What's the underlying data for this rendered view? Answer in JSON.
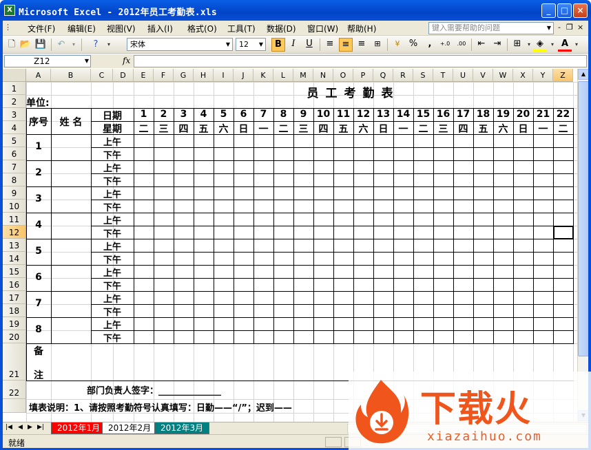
{
  "window": {
    "title": "Microsoft Excel - 2012年员工考勤表.xls",
    "app_icon": "excel-icon",
    "controls": [
      "_",
      "□",
      "×"
    ]
  },
  "menubar": {
    "items": [
      "文件(F)",
      "编辑(E)",
      "视图(V)",
      "插入(I)",
      "格式(O)",
      "工具(T)",
      "数据(D)",
      "窗口(W)",
      "帮助(H)"
    ],
    "help_placeholder": "键入需要帮助的问题",
    "mdi_controls": [
      "-",
      "❐",
      "×"
    ]
  },
  "toolbar": {
    "font_name": "宋体",
    "font_size": "12",
    "bold_label": "B",
    "italic_label": "I",
    "underline_label": "U",
    "percent_label": "%",
    "comma_label": ",",
    "inc_decimal_label": "+.0",
    "dec_decimal_label": ".00",
    "font_color_label": "A",
    "accent_font_color": "#ff0000",
    "fill_color": "#ffff00"
  },
  "formula_bar": {
    "name_box": "Z12",
    "fx_label": "fx",
    "formula": ""
  },
  "sheet": {
    "columns": [
      "A",
      "B",
      "C",
      "D",
      "E",
      "F",
      "G",
      "H",
      "I",
      "J",
      "K",
      "L",
      "M",
      "N",
      "O",
      "P",
      "Q",
      "R",
      "S",
      "T",
      "U",
      "V",
      "W",
      "X",
      "Y",
      "Z"
    ],
    "selected_column": "Z",
    "rows": [
      "1",
      "2",
      "3",
      "4",
      "5",
      "6",
      "7",
      "8",
      "9",
      "10",
      "11",
      "12",
      "13",
      "14",
      "15",
      "16",
      "17",
      "18",
      "19",
      "20",
      "21",
      "22",
      ""
    ],
    "selected_row": "12",
    "title": "员工考勤表",
    "unit_label": "单位:",
    "seq_label": "序号",
    "name_label": "姓 名",
    "date_label": "日期",
    "week_label": "星期",
    "days": [
      "1",
      "2",
      "3",
      "4",
      "5",
      "6",
      "7",
      "8",
      "9",
      "10",
      "11",
      "12",
      "13",
      "14",
      "15",
      "16",
      "17",
      "18",
      "19",
      "20",
      "21",
      "22"
    ],
    "weekdays": [
      "二",
      "三",
      "四",
      "五",
      "六",
      "日",
      "一",
      "二",
      "三",
      "四",
      "五",
      "六",
      "日",
      "一",
      "二",
      "三",
      "四",
      "五",
      "六",
      "日",
      "一",
      "二"
    ],
    "employees": [
      "1",
      "2",
      "3",
      "4",
      "5",
      "6",
      "7",
      "8"
    ],
    "am_label": "上午",
    "pm_label": "下午",
    "remarks_top": "备",
    "remarks_bottom": "注",
    "signature_label": "部门负责人签字：______________",
    "instructions": "填表说明：1、请按照考勤符号认真填写：日勤——“/”；迟到——"
  },
  "tabs": {
    "nav": [
      "|◀",
      "◀",
      "▶",
      "▶|"
    ],
    "sheets": [
      {
        "label": "2012年1月",
        "color": "#ff0000",
        "active": false
      },
      {
        "label": "2012年2月",
        "color": "#ffffff",
        "active": true
      },
      {
        "label": "2012年3月",
        "color": "#008080",
        "active": false
      }
    ]
  },
  "status": {
    "text": "就绪"
  },
  "watermark": {
    "cn": "下载火",
    "en": "xiazaihuo.com",
    "color": "#f0561c"
  }
}
